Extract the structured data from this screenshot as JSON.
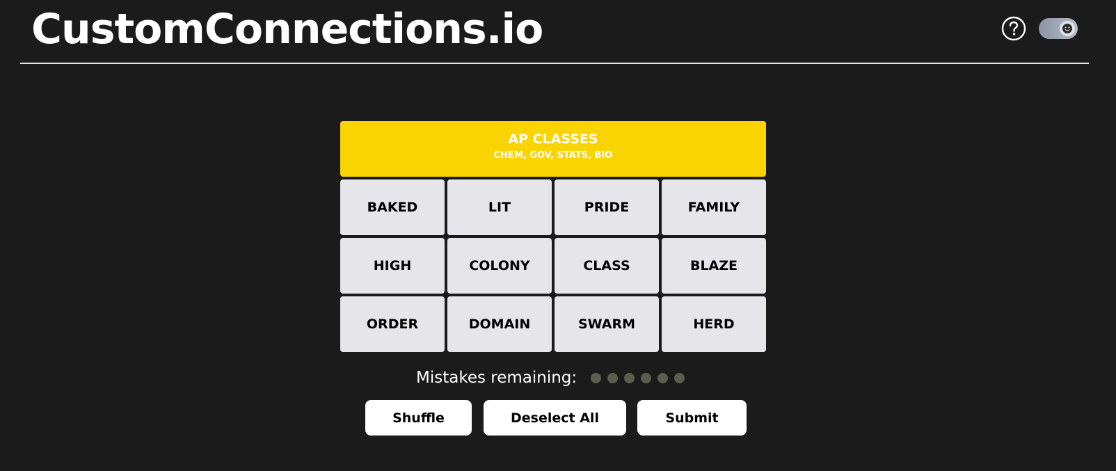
{
  "header": {
    "site_title": "CustomConnections.io",
    "help_icon": "question-circle-icon",
    "theme_toggle_icon": "smiley-face-icon"
  },
  "solved_groups": [
    {
      "title": "AP CLASSES",
      "members": "CHEM, GOV, STATS, BIO",
      "color": "#f9d400"
    }
  ],
  "tiles": [
    "BAKED",
    "LIT",
    "PRIDE",
    "FAMILY",
    "HIGH",
    "COLONY",
    "CLASS",
    "BLAZE",
    "ORDER",
    "DOMAIN",
    "SWARM",
    "HERD"
  ],
  "mistakes": {
    "label": "Mistakes remaining:",
    "remaining": 6
  },
  "actions": {
    "shuffle": "Shuffle",
    "deselect_all": "Deselect All",
    "submit": "Submit"
  },
  "colors": {
    "background": "#1b1b1b",
    "tile": "#e6e6ea",
    "mistake_dot": "#5a5e4d"
  }
}
